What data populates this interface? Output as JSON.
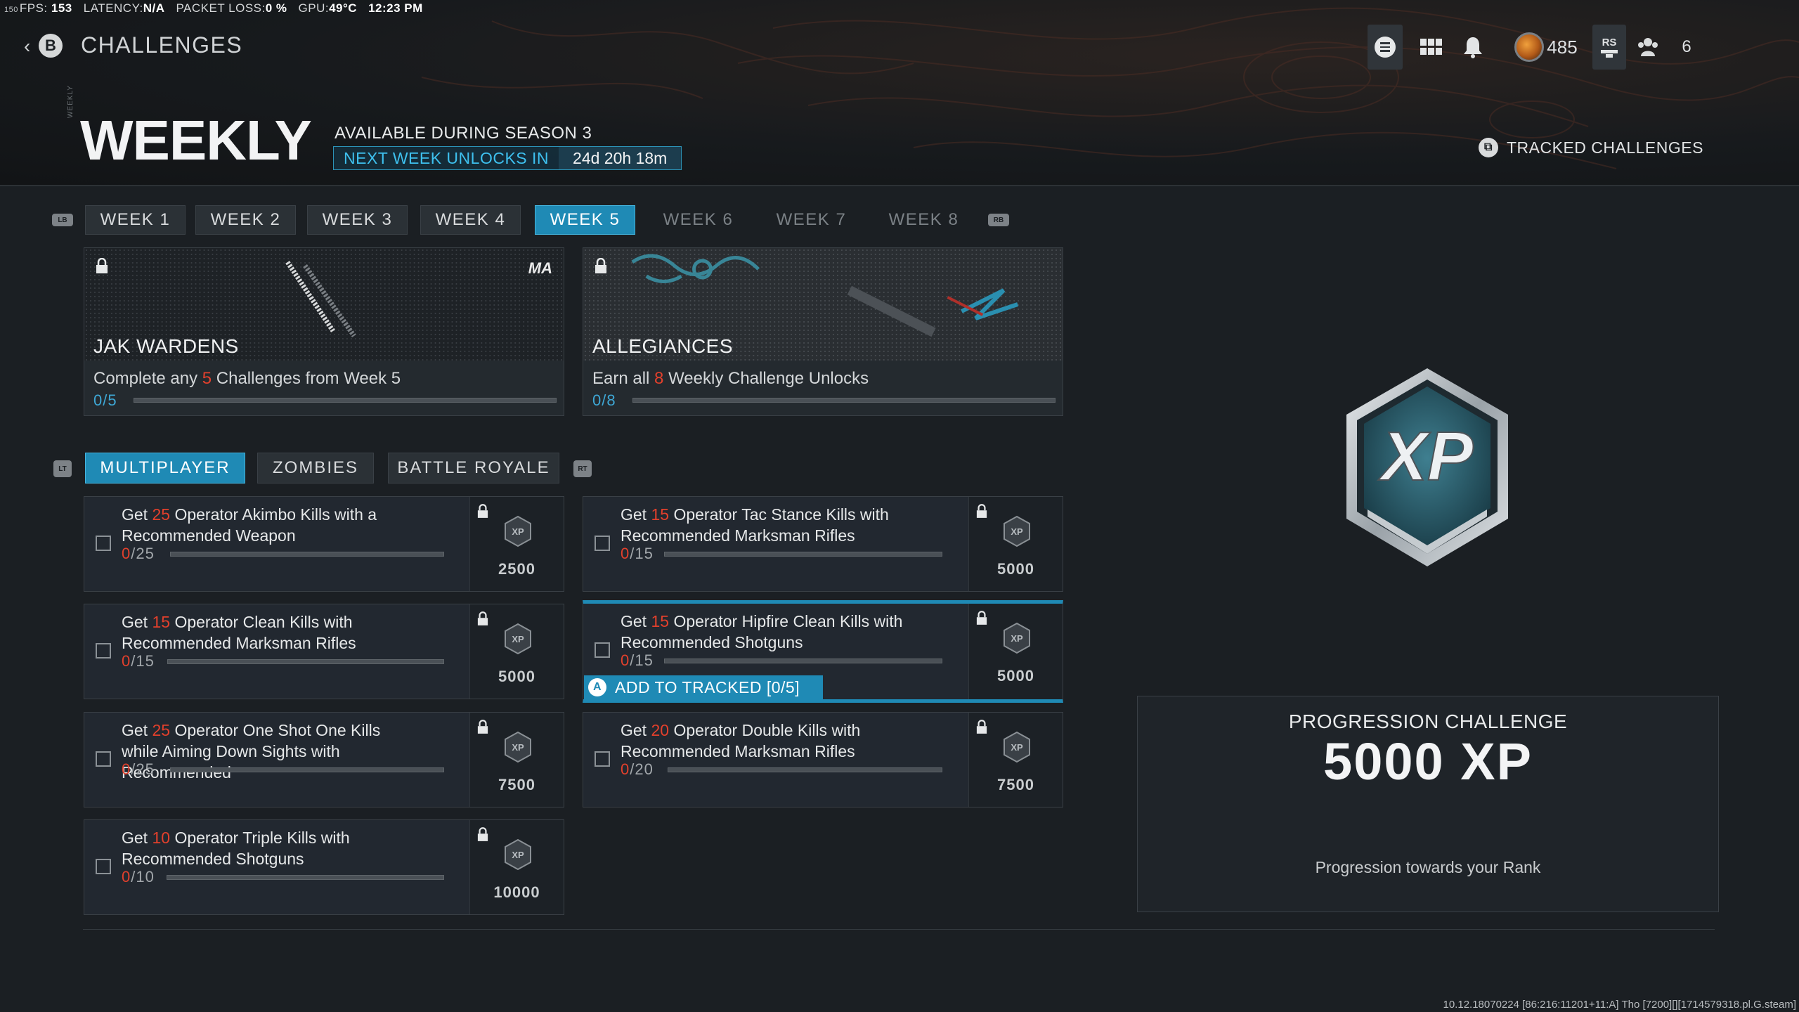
{
  "perf": {
    "fps_small": "150",
    "fps_label": "FPS:",
    "fps_value": "153",
    "latency_label": "LATENCY:",
    "latency_value": "N/A",
    "packet_loss_label": "PACKET LOSS:",
    "packet_loss_value": "0 %",
    "gpu_label": "GPU:",
    "gpu_value": "49°C",
    "time": "12:23 PM"
  },
  "nav": {
    "back_chevron": "‹",
    "back_button": "B",
    "title": "CHALLENGES"
  },
  "topbar": {
    "currency_amount": "485",
    "rs_label": "RS",
    "friends_count": "6",
    "icons": [
      "menu-icon",
      "grid-icon",
      "bell-icon",
      "currency-coin-icon",
      "rs-icon",
      "friends-icon"
    ]
  },
  "header": {
    "side_label": "WEEKLY",
    "title": "WEEKLY",
    "available": "AVAILABLE DURING SEASON 3",
    "unlock_label": "NEXT WEEK UNLOCKS IN",
    "unlock_time": "24d 20h 18m",
    "tracked": "TRACKED CHALLENGES"
  },
  "controls": {
    "lb": "LB",
    "rb": "RB",
    "lt": "LT",
    "rt": "RT",
    "a": "A"
  },
  "weeks": [
    {
      "label": "WEEK 1",
      "state": "normal"
    },
    {
      "label": "WEEK 2",
      "state": "normal"
    },
    {
      "label": "WEEK 3",
      "state": "normal"
    },
    {
      "label": "WEEK 4",
      "state": "normal"
    },
    {
      "label": "WEEK 5",
      "state": "active"
    },
    {
      "label": "WEEK 6",
      "state": "dim"
    },
    {
      "label": "WEEK 7",
      "state": "dim"
    },
    {
      "label": "WEEK 8",
      "state": "dim"
    }
  ],
  "rewards": [
    {
      "name": "JAK WARDENS",
      "desc_pre": "Complete any ",
      "desc_num": "5",
      "desc_post": " Challenges from Week 5",
      "progress": "0/5",
      "fraction": 0,
      "logo": "MA"
    },
    {
      "name": "ALLEGIANCES",
      "desc_pre": "Earn all ",
      "desc_num": "8",
      "desc_post": " Weekly Challenge Unlocks",
      "progress": "0/8",
      "fraction": 0
    }
  ],
  "modes": [
    {
      "label": "MULTIPLAYER",
      "active": true
    },
    {
      "label": "ZOMBIES",
      "active": false
    },
    {
      "label": "BATTLE ROYALE",
      "active": false
    }
  ],
  "challenges": [
    {
      "pre": "Get ",
      "num": "25",
      "post": " Operator Akimbo Kills with a Recommended Weapon",
      "zero": "0",
      "total": "/25",
      "xp": "2500",
      "fraction": 0
    },
    {
      "pre": "Get ",
      "num": "15",
      "post": " Operator Tac Stance Kills with Recommended Marksman Rifles",
      "zero": "0",
      "total": "/15",
      "xp": "5000",
      "fraction": 0
    },
    {
      "pre": "Get ",
      "num": "15",
      "post": " Operator Clean Kills with Recommended Marksman Rifles",
      "zero": "0",
      "total": "/15",
      "xp": "5000",
      "fraction": 0
    },
    {
      "pre": "Get ",
      "num": "15",
      "post": " Operator Hipfire Clean Kills with Recommended Shotguns",
      "zero": "0",
      "total": "/15",
      "xp": "5000",
      "fraction": 0
    },
    {
      "pre": "Get ",
      "num": "25",
      "post": " Operator One Shot One Kills while Aiming Down Sights with Recommended",
      "zero": "0",
      "total": "/25",
      "xp": "7500",
      "fraction": 0
    },
    {
      "pre": "Get ",
      "num": "20",
      "post": " Operator Double Kills with Recommended Marksman Rifles",
      "zero": "0",
      "total": "/20",
      "xp": "7500",
      "fraction": 0
    },
    {
      "pre": "Get ",
      "num": "10",
      "post": " Operator Triple Kills with Recommended Shotguns",
      "zero": "0",
      "total": "/10",
      "xp": "10000",
      "fraction": 0
    }
  ],
  "add_tracked": "ADD TO TRACKED [0/5]",
  "emblem_text": "XP",
  "xp_badge_text": "XP",
  "progression": {
    "title": "PROGRESSION CHALLENGE",
    "value": "5000 XP",
    "desc": "Progression towards your Rank"
  },
  "build": "10.12.18070224 [86:216:11201+11:A] Tho [7200][][1714579318.pl.G.steam]",
  "colors": {
    "accent": "#1f8ab5",
    "accent_text": "#3ec0ee",
    "highlight_number": "#e2402c",
    "background": "#1b1f23"
  }
}
